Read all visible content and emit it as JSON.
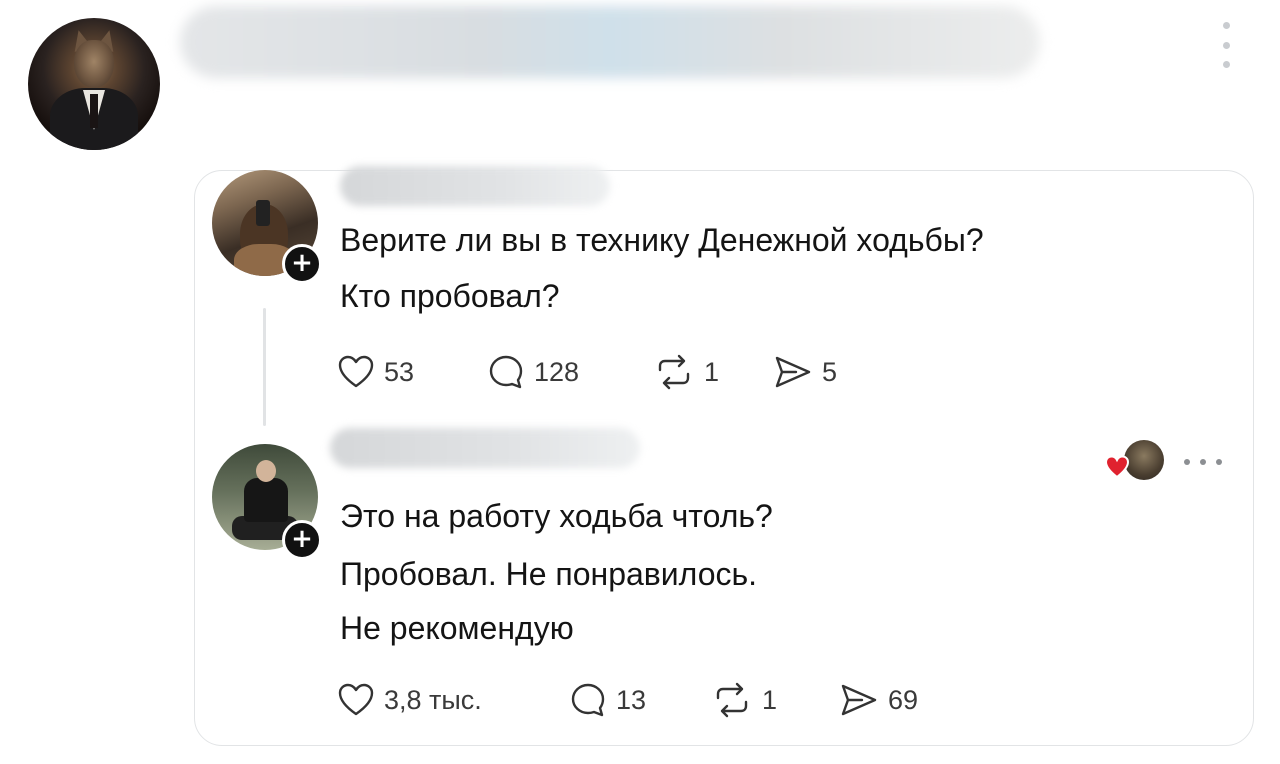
{
  "post": {
    "author_name_redacted": true
  },
  "quoted": {
    "comments": [
      {
        "lines": [
          "Верите ли вы в технику Денежной ходьбы?",
          "Кто пробовал?"
        ],
        "actions": {
          "likes": "53",
          "replies": "128",
          "reposts": "1",
          "shares": "5"
        }
      },
      {
        "lines": [
          "Это на работу ходьба чтоль?",
          "Пробовал. Не понравилось.",
          "Не рекомендую"
        ],
        "actions": {
          "likes": "3,8 тыс.",
          "replies": "13",
          "reposts": "1",
          "shares": "69"
        }
      }
    ]
  },
  "icons": {
    "more_vertical": "kebab-icon",
    "more_horizontal": "ellipsis-icon",
    "like": "heart-icon",
    "reply": "speech-bubble-icon",
    "repost": "repost-icon",
    "share": "send-icon",
    "follow": "plus-icon"
  },
  "colors": {
    "like_heart": "#e0222f",
    "text": "#141414",
    "border": "#e2e4e6"
  }
}
